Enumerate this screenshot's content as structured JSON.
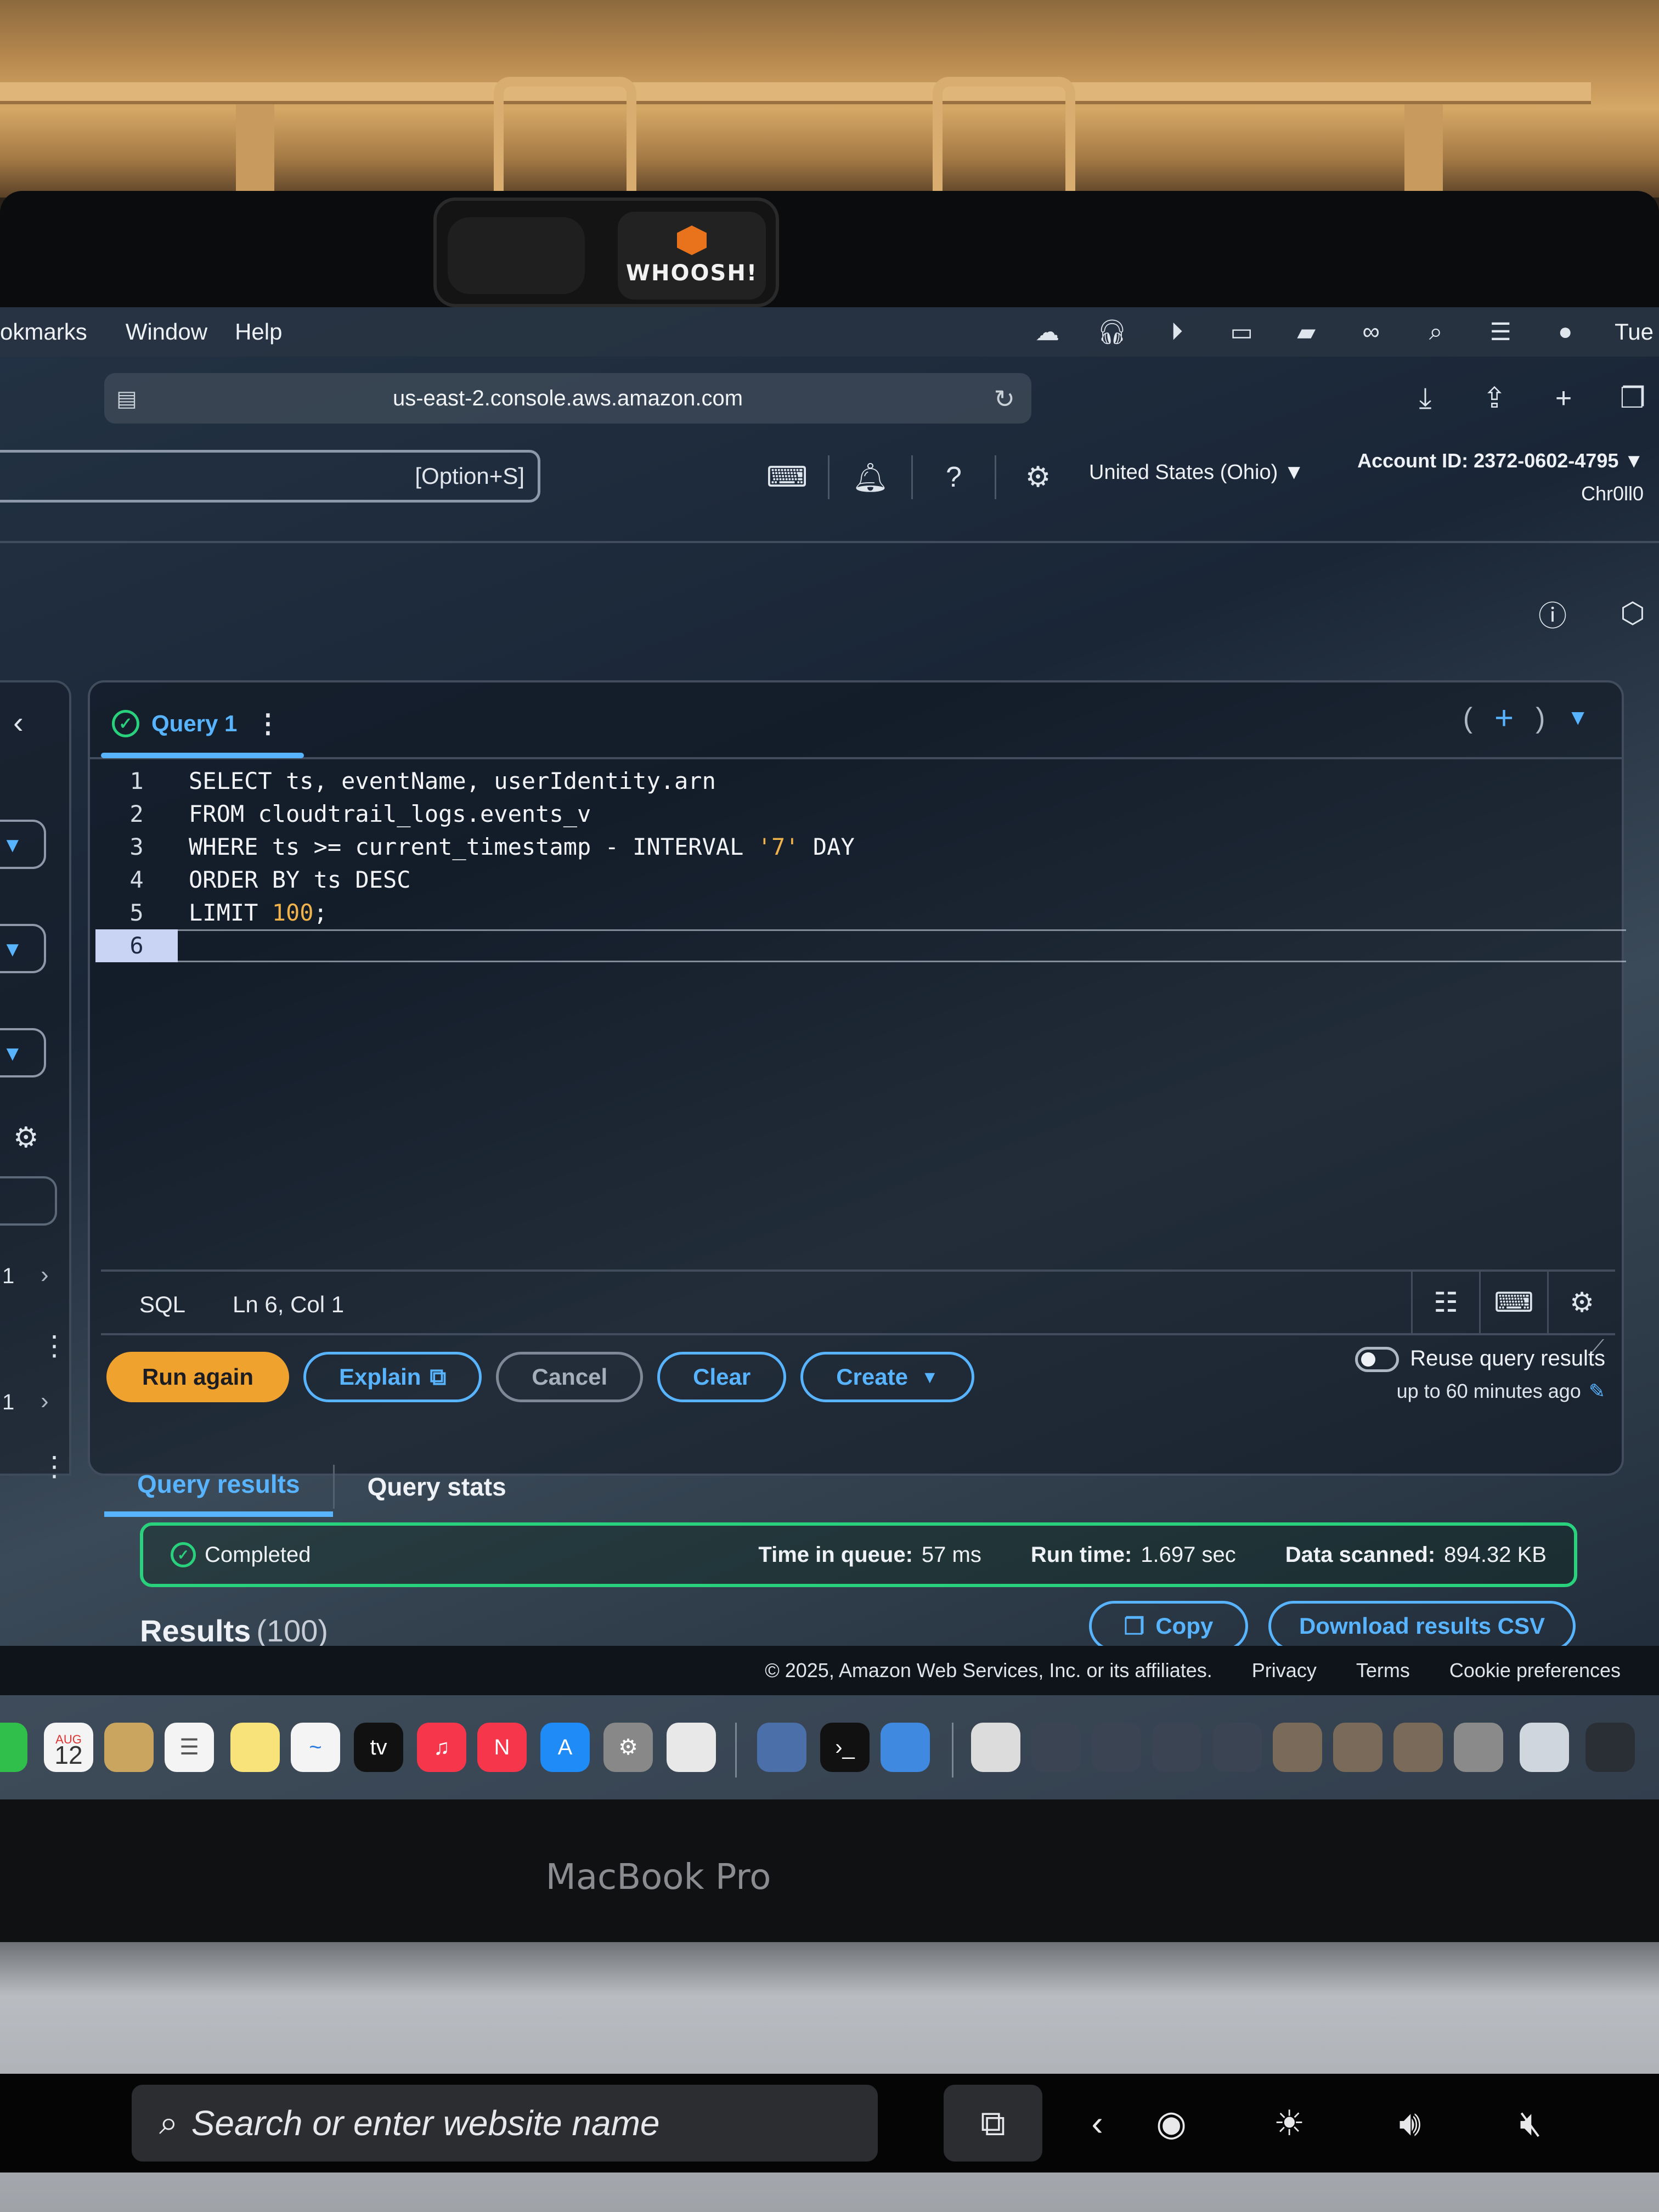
{
  "macos": {
    "menu_items": [
      "okmarks",
      "Window",
      "Help"
    ],
    "clock": "Tue"
  },
  "browser": {
    "url": "us-east-2.console.aws.amazon.com"
  },
  "aws_header": {
    "search_shortcut": "[Option+S]",
    "region": "United States (Ohio) ▼",
    "account_id": "Account ID: 2372-0602-4795 ▼",
    "username": "Chr0ll0"
  },
  "editor": {
    "tab_label": "Query 1",
    "lines": [
      {
        "num": "1",
        "text": "SELECT ts, eventName, userIdentity.arn"
      },
      {
        "num": "2",
        "text": "FROM cloudtrail_logs.events_v"
      },
      {
        "num": "3",
        "pre": "WHERE ts >= current_timestamp - INTERVAL ",
        "str": "'7'",
        "post": " DAY"
      },
      {
        "num": "4",
        "text": "ORDER BY ts DESC"
      },
      {
        "num": "5",
        "pre": "LIMIT ",
        "str": "100",
        "post": ";"
      },
      {
        "num": "6",
        "text": ""
      }
    ],
    "language": "SQL",
    "cursor_position": "Ln 6, Col 1"
  },
  "actions": {
    "run_again": "Run again",
    "explain": "Explain",
    "cancel": "Cancel",
    "clear": "Clear",
    "create": "Create",
    "reuse_label": "Reuse query results",
    "reuse_sub": "up to 60 minutes ago"
  },
  "results": {
    "tabs": [
      "Query results",
      "Query stats"
    ],
    "status": "Completed",
    "time_in_queue_label": "Time in queue:",
    "time_in_queue": "57 ms",
    "run_time_label": "Run time:",
    "run_time": "1.697 sec",
    "data_scanned_label": "Data scanned:",
    "data_scanned": "894.32 KB",
    "heading": "Results",
    "count": "(100)",
    "copy": "Copy",
    "download": "Download results CSV"
  },
  "left_panel": {
    "row_a": "1",
    "row_b": "1"
  },
  "footer": {
    "copyright": "© 2025, Amazon Web Services, Inc. or its affiliates.",
    "privacy": "Privacy",
    "terms": "Terms",
    "cookies": "Cookie preferences"
  },
  "dock": {
    "calendar_month": "AUG",
    "calendar_day": "12",
    "tv_label": "tv"
  },
  "hardware": {
    "webcam_cover": "WHOOSH!",
    "brand": "MacBook Pro",
    "touchbar_search": "Search or enter website name"
  },
  "colors": {
    "accent": "#58b4ff",
    "primary_button": "#f0a22e",
    "success": "#29d17d"
  }
}
